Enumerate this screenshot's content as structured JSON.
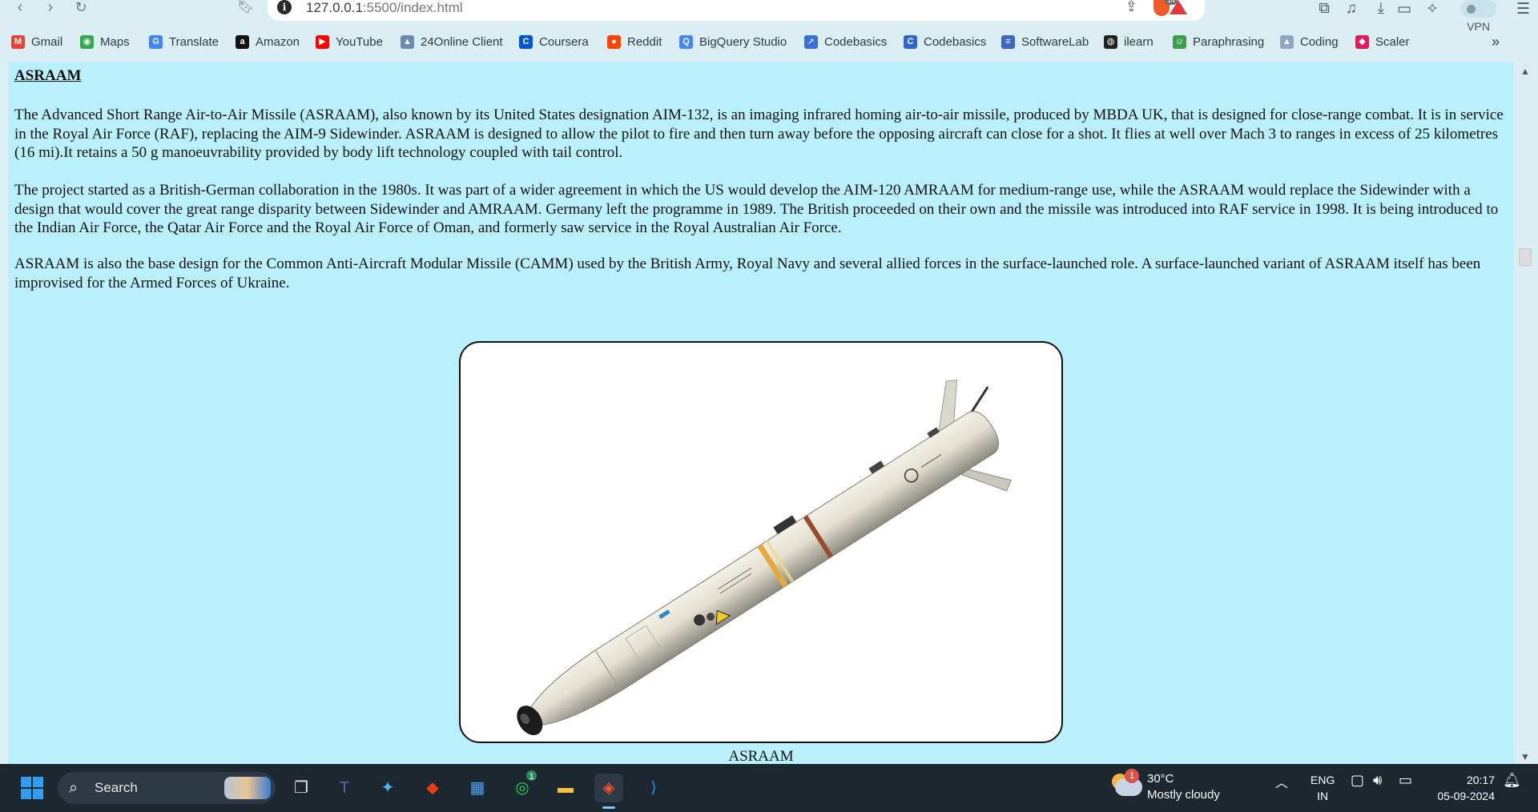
{
  "browser": {
    "url_host": "127.0.0.1",
    "url_rest": ":5500/index.html",
    "shield_count": "14",
    "vpn_label": "VPN"
  },
  "bookmarks": [
    {
      "label": "Gmail",
      "icon": "gmail-icon",
      "color": "#ea4335",
      "glyph": "M"
    },
    {
      "label": "Maps",
      "icon": "maps-icon",
      "color": "#34a853",
      "glyph": "◉"
    },
    {
      "label": "Translate",
      "icon": "translate-icon",
      "color": "#4285f4",
      "glyph": "G"
    },
    {
      "label": "Amazon",
      "icon": "amazon-icon",
      "color": "#111111",
      "glyph": "a"
    },
    {
      "label": "YouTube",
      "icon": "youtube-icon",
      "color": "#ff0000",
      "glyph": "▶"
    },
    {
      "label": "24Online Client",
      "icon": "24online-icon",
      "color": "#6c8bb0",
      "glyph": "▲"
    },
    {
      "label": "Coursera",
      "icon": "coursera-icon",
      "color": "#0056d2",
      "glyph": "C"
    },
    {
      "label": "Reddit",
      "icon": "reddit-icon",
      "color": "#ff4500",
      "glyph": "●"
    },
    {
      "label": "BigQuery Studio",
      "icon": "bigquery-icon",
      "color": "#4386fa",
      "glyph": "Q"
    },
    {
      "label": "Codebasics",
      "icon": "rocket-icon",
      "color": "#3d6fd8",
      "glyph": "➚"
    },
    {
      "label": "Codebasics",
      "icon": "codebasics-icon",
      "color": "#2e66c9",
      "glyph": "C"
    },
    {
      "label": "SoftwareLab",
      "icon": "softwarelab-icon",
      "color": "#3b69c0",
      "glyph": "≡"
    },
    {
      "label": "ilearn",
      "icon": "globe-icon",
      "color": "#222222",
      "glyph": "◍"
    },
    {
      "label": "Paraphrasing",
      "icon": "paraphrasing-icon",
      "color": "#3f9e4d",
      "glyph": "☺"
    },
    {
      "label": "Coding",
      "icon": "coding-icon",
      "color": "#8fa6c4",
      "glyph": "▲"
    },
    {
      "label": "Scaler",
      "icon": "scaler-icon",
      "color": "#e3195b",
      "glyph": "◆"
    }
  ],
  "article": {
    "title": "ASRAAM",
    "p1": "The Advanced Short Range Air-to-Air Missile (ASRAAM), also known by its United States designation AIM-132, is an imaging infrared homing air-to-air missile, produced by MBDA UK, that is designed for close-range combat. It is in service in the Royal Air Force (RAF), replacing the AIM-9 Sidewinder. ASRAAM is designed to allow the pilot to fire and then turn away before the opposing aircraft can close for a shot. It flies at well over Mach 3 to ranges in excess of 25 kilometres (16 mi).It retains a 50 g manoeuvrability provided by body lift technology coupled with tail control.",
    "p2": "The project started as a British-German collaboration in the 1980s. It was part of a wider agreement in which the US would develop the AIM-120 AMRAAM for medium-range use, while the ASRAAM would replace the Sidewinder with a design that would cover the great range disparity between Sidewinder and AMRAAM. Germany left the programme in 1989. The British proceeded on their own and the missile was introduced into RAF service in 1998. It is being introduced to the Indian Air Force, the Qatar Air Force and the Royal Air Force of Oman, and formerly saw service in the Royal Australian Air Force.",
    "p3": "ASRAAM is also the base design for the Common Anti-Aircraft Modular Missile (CAMM) used by the British Army, Royal Navy and several allied forces in the surface-launched role. A surface-launched variant of ASRAAM itself has been improvised for the Armed Forces of Ukraine.",
    "caption": "ASRAAM"
  },
  "taskbar": {
    "search_label": "Search",
    "whatsapp_badge": "1",
    "weather_badge": "1",
    "temperature": "30°C",
    "condition": "Mostly cloudy",
    "lang_line1": "ENG",
    "lang_line2": "IN",
    "time": "20:17",
    "date": "05-09-2024"
  }
}
